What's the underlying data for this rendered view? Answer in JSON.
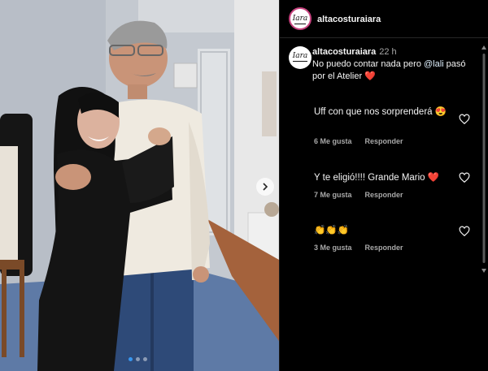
{
  "header": {
    "username": "altacosturaiara",
    "avatar_text": "Iara"
  },
  "caption": {
    "username": "altacosturaiara",
    "time": "22 h",
    "text_before": "No puedo contar nada pero ",
    "mention": "@lali",
    "text_after": " pasó por el Atelier ❤️"
  },
  "comments": [
    {
      "text": "Uff con que nos sorprenderá 😍",
      "likes": "6 Me gusta",
      "reply": "Responder"
    },
    {
      "text": "Y te eligió!!!! Grande Mario ❤️",
      "likes": "7 Me gusta",
      "reply": "Responder"
    },
    {
      "text": "👏👏👏",
      "likes": "3 Me gusta",
      "reply": "Responder"
    }
  ],
  "carousel": {
    "slide_count": 3,
    "active_slide": 1
  },
  "colors": {
    "panel_bg": "#000000",
    "link": "#e0f1ff",
    "accent_ring": "#c6427e",
    "heart_red": "#e0245e",
    "active_dot": "#3897f0"
  },
  "icons": [
    "heart-outline-icon",
    "chevron-right-icon"
  ]
}
